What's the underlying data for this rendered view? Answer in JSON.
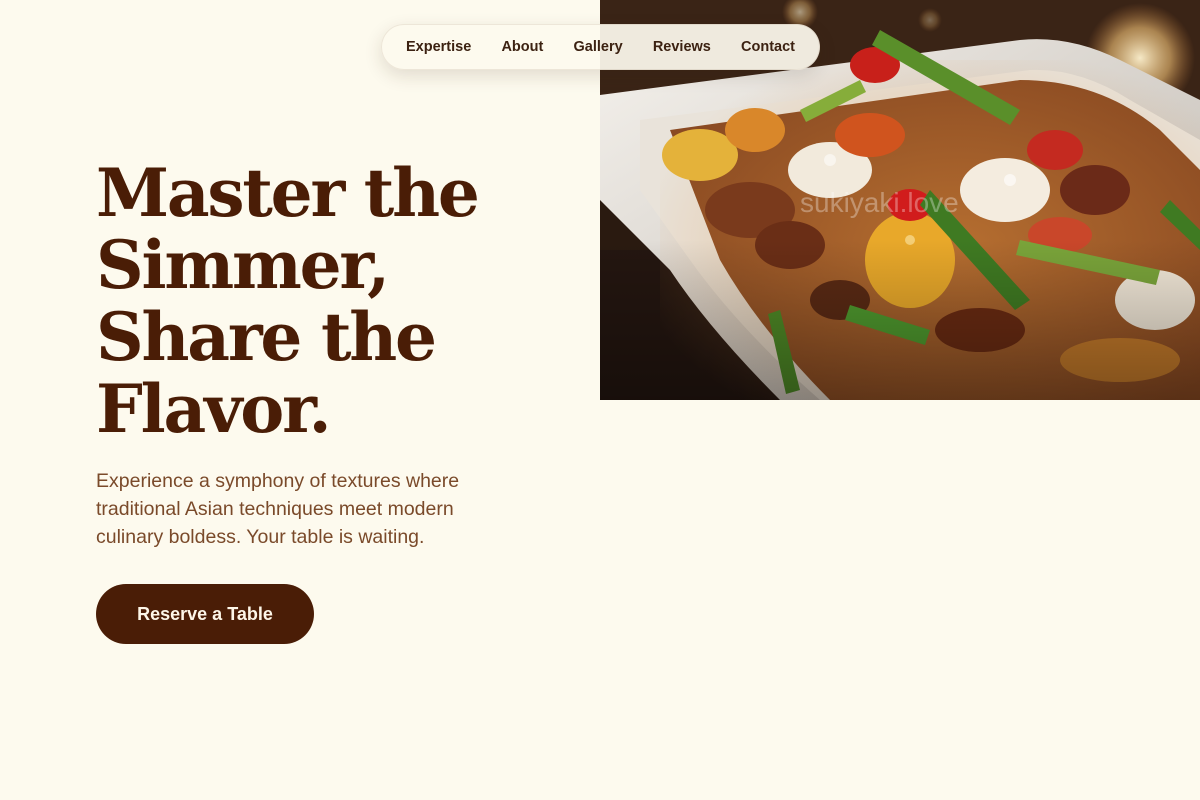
{
  "nav": {
    "items": [
      {
        "label": "Expertise"
      },
      {
        "label": "About"
      },
      {
        "label": "Gallery"
      },
      {
        "label": "Reviews"
      },
      {
        "label": "Contact"
      }
    ]
  },
  "hero": {
    "title": "Master the Simmer, Share the Flavor.",
    "subtitle": "Experience a symphony of textures where traditional Asian techniques meet modern culinary boldess. Your table is waiting.",
    "cta_label": "Reserve a Table",
    "image": {
      "subject": "stir-fry dish with vegetables, meat and quail eggs on a white plate",
      "watermark": "sukiyaki.love"
    }
  },
  "colors": {
    "background": "#fdfaee",
    "brand_brown": "#4a1d06",
    "body_text": "#7a4a2a",
    "nav_text": "#3c2212",
    "button_text": "#fdf6e8"
  }
}
